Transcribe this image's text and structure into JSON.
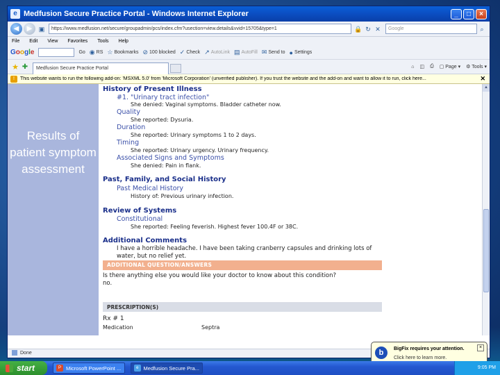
{
  "window": {
    "title": "Medfusion Secure Practice Portal - Windows Internet Explorer",
    "buttons": {
      "minimize": "_",
      "maximize": "□",
      "close": "×"
    }
  },
  "address_bar": {
    "url": "https://www.medfusion.net/secure/groupadmin/pcs/index.cfm?usection=view.details&vvid=15705&type=1",
    "search_placeholder": "Google"
  },
  "menu": [
    "File",
    "Edit",
    "View",
    "Favorites",
    "Tools",
    "Help"
  ],
  "google_toolbar": {
    "go_label": "Go",
    "items": [
      {
        "label": "RS",
        "icon": "rss-icon"
      },
      {
        "label": "Bookmarks",
        "icon": "star-icon"
      },
      {
        "label": "100 blocked",
        "icon": "popup-blocker-icon"
      },
      {
        "label": "Check",
        "icon": "spellcheck-icon"
      },
      {
        "label": "AutoLink",
        "icon": "autolink-icon"
      },
      {
        "label": "AutoFill",
        "icon": "autofill-icon"
      },
      {
        "label": "Send to",
        "icon": "send-icon"
      },
      {
        "label": "Settings",
        "icon": "settings-icon"
      }
    ]
  },
  "favorites_bar": {
    "tab_title": "Medfusion Secure Practice Portal",
    "page_label": "Page",
    "tools_label": "Tools"
  },
  "infobar": {
    "message": "This website wants to run the following add-on: 'MSXML 5.0' from 'Microsoft Corporation' (unverified publisher). If you trust the website and the add-on and want to allow it to run, click here..."
  },
  "slide_caption": "Results of patient symptom assessment",
  "document": {
    "hpi_title": "History of Present Illness",
    "complaint": "#1. \"Urinary tract infection\"",
    "complaint_text": "She denied: Vaginal symptoms. Bladder catheter now.",
    "quality_label": "Quality",
    "quality_text": "She reported: Dysuria.",
    "duration_label": "Duration",
    "duration_text": "She reported: Urinary symptoms 1 to 2 days.",
    "timing_label": "Timing",
    "timing_text": "She reported: Urinary urgency. Urinary frequency.",
    "assoc_label": "Associated Signs and Symptoms",
    "assoc_text": "She denied: Pain in flank.",
    "pfsh_title": "Past, Family, and Social History",
    "pmh_label": "Past Medical History",
    "pmh_text": "History of: Previous urinary infection.",
    "ros_title": "Review of Systems",
    "const_label": "Constitutional",
    "const_text": "She reported: Feeling feverish. Highest fever 100.4F or 38C.",
    "addl_title": "Additional Comments",
    "addl_text": "I have a horrible headache. I have been taking cranberry capsules and drinking lots of water, but no relief yet.",
    "qa_band": "ADDITIONAL QUESTION/ANSWERS",
    "qa_question": "Is there anything else you would like your doctor to know about this condition?",
    "qa_answer": "no.",
    "rx_band": "PRESCRIPTION(S)",
    "rx_label": "Rx # 1",
    "rx_medication": "Medication",
    "rx_value": "Septra"
  },
  "status": {
    "text": "Done"
  },
  "notification": {
    "logo": "b",
    "title": "BigFix requires your attention.",
    "subtitle": "Click here to learn more.",
    "close": "×"
  },
  "taskbar": {
    "start": "start",
    "buttons": [
      {
        "label": "Microsoft PowerPoint ...",
        "active": false
      },
      {
        "label": "Medfusion Secure Pra...",
        "active": true
      }
    ],
    "clock": "9:05 PM"
  }
}
